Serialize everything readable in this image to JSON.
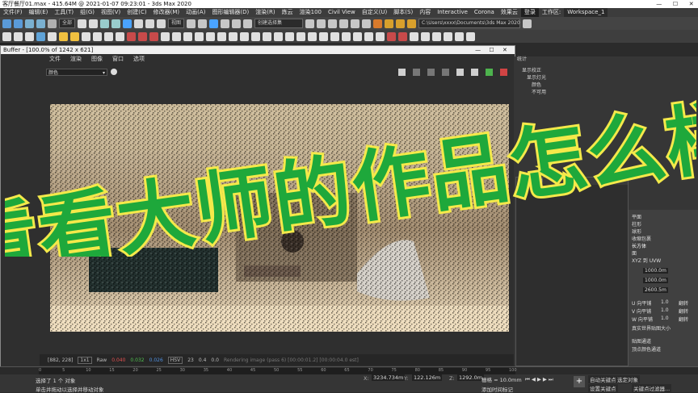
{
  "window": {
    "title": "客厅餐厅01.max - 415.64M @ 2021-01-07 09:23:01 - 3ds Max 2020"
  },
  "menu": [
    "文件(F)",
    "编辑(E)",
    "工具(T)",
    "组(G)",
    "视图(V)",
    "创建(C)",
    "修改器(M)",
    "动画(A)",
    "图形编辑器(D)",
    "渲染(R)",
    "炼云",
    "渲染100",
    "Civil View",
    "自定义(U)",
    "脚本(S)",
    "内容",
    "Interactive",
    "Corona",
    "效果云"
  ],
  "login": "登录",
  "workspace": {
    "label": "工作区:",
    "value": "Workspace_1"
  },
  "toolbar": {
    "selection_filter": "全部",
    "view": "视图",
    "create_selection": "创建选择集",
    "path": "C:\\Users\\xxxx\\Documents\\3ds Max 2020"
  },
  "frame_buffer": {
    "title": "Buffer - [100.0% of 1242 x 621]",
    "menu": [
      "文件",
      "渲染",
      "图像",
      "窗口",
      "选项"
    ],
    "channel": "颜色",
    "status": {
      "coords": "[882, 228]",
      "mode": "1x1",
      "raw": "Raw",
      "r": "0.040",
      "g": "0.032",
      "b": "0.026",
      "hsv": "HSV",
      "h": "23",
      "s": "0.4",
      "v": "0.0",
      "msg": "Rendering image (pass 6) [00:00:01.2] [00:00:04.0 est]"
    }
  },
  "command_panel": {
    "tab": "统计",
    "tree": [
      "显示校正",
      "显示灯光",
      "颜色",
      "不可用"
    ],
    "properties_title": "属性 | 背面",
    "options": [
      "平面",
      "柱形",
      "球形",
      "收缩包裹",
      "长方体",
      "面",
      "XYZ 到 UVW"
    ],
    "selected_option": "长方体",
    "length": "1000.0m",
    "width": "1000.0m",
    "height": "2600.5m",
    "tile_labels": [
      "U 向平铺",
      "V 向平铺",
      "W 向平铺"
    ],
    "tile_values": [
      "1.0",
      "1.0",
      "1.0"
    ],
    "flip": "翻转",
    "real_world": "真实世界贴图大小",
    "channel_label": "贴图通道",
    "vertex_color": "顶点颜色通道"
  },
  "timeline": {
    "ticks": [
      "0",
      "5",
      "10",
      "15",
      "20",
      "25",
      "30",
      "35",
      "40",
      "45",
      "50",
      "55",
      "60",
      "65",
      "70",
      "75",
      "80",
      "85",
      "90",
      "95",
      "100"
    ]
  },
  "status": {
    "selected": "选择了 1 个 对象",
    "hint": "单击并拖动以选择并移动对象",
    "x": "3234.734m",
    "y": "122.126m",
    "z": "1292.0m",
    "grid": "栅格 = 10.0mm",
    "auto_key": "自动关键点",
    "set_key": "设置关键点",
    "selected_set": "选定对象",
    "key_filter": "关键点过滤器...",
    "add_time_tag": "添加时间标记"
  },
  "overlay": {
    "text": "看看大师的作品怎么样"
  },
  "colors": {
    "overlay_fill": "#1ea83b",
    "overlay_stroke": "#f4e94a",
    "accent": "#2c8bd6"
  }
}
